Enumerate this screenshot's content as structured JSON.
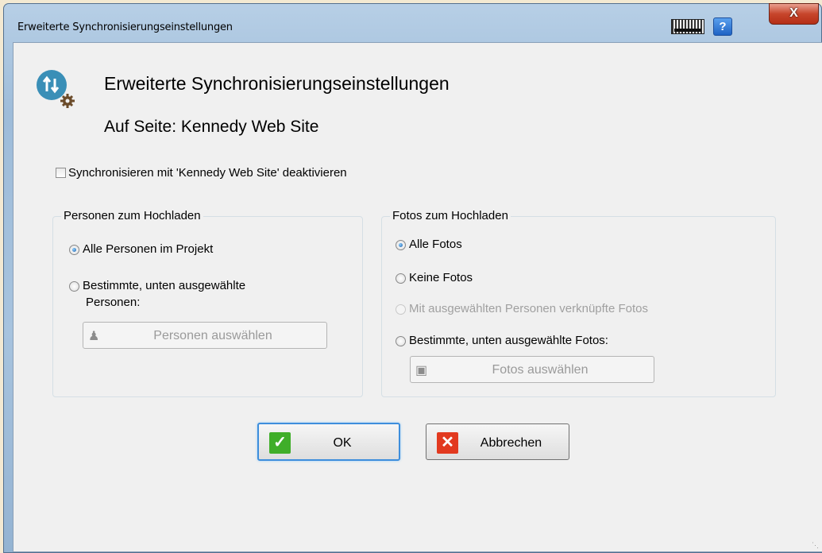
{
  "window": {
    "title": "Erweiterte Synchronisierungseinstellungen",
    "help_label": "?",
    "close_label": "X"
  },
  "header": {
    "title": "Erweiterte Synchronisierungseinstellungen",
    "subtitle": "Auf Seite: Kennedy Web Site"
  },
  "disable_sync": {
    "label": "Synchronisieren mit 'Kennedy Web Site' deaktivieren",
    "checked": false
  },
  "persons_group": {
    "legend": "Personen zum Hochladen",
    "options": [
      {
        "label": "Alle Personen im Projekt",
        "selected": true
      },
      {
        "label_line1": "Bestimmte, unten ausgewählte",
        "label_line2": "Personen:",
        "selected": false
      }
    ],
    "select_button": "Personen auswählen"
  },
  "photos_group": {
    "legend": "Fotos zum Hochladen",
    "options": [
      {
        "label": "Alle Fotos",
        "selected": true
      },
      {
        "label": "Keine Fotos",
        "selected": false
      },
      {
        "label": "Mit ausgewählten Personen verknüpfte Fotos",
        "selected": false,
        "disabled": true
      },
      {
        "label": "Bestimmte, unten ausgewählte Fotos:",
        "selected": false
      }
    ],
    "select_button": "Fotos auswählen"
  },
  "buttons": {
    "ok": "OK",
    "cancel": "Abbrechen"
  },
  "colors": {
    "ok_icon": "#3fae29",
    "cancel_icon": "#e2391f",
    "sync_icon": "#3a8fb7"
  }
}
